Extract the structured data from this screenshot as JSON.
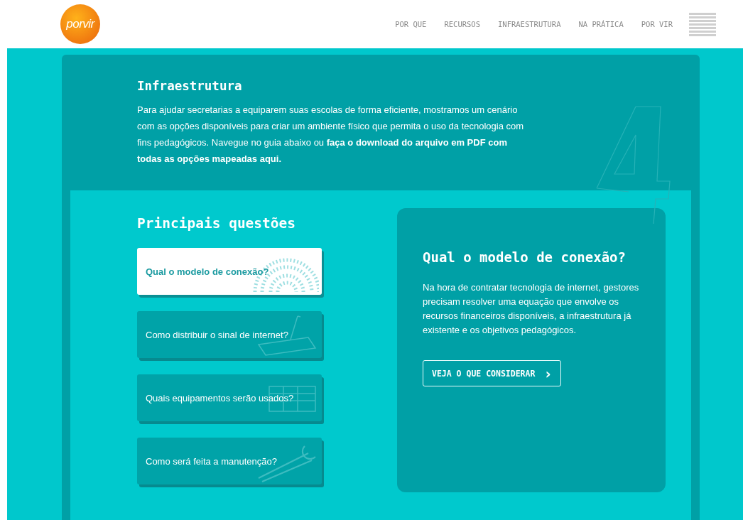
{
  "header": {
    "logo": "porvir",
    "nav": [
      {
        "label": "POR QUE"
      },
      {
        "label": "RECURSOS"
      },
      {
        "label": "INFRAESTRUTURA"
      },
      {
        "label": "NA PRÁTICA"
      },
      {
        "label": "POR VIR"
      }
    ]
  },
  "intro": {
    "title": "Infraestrutura",
    "text": "Para ajudar secretarias a equiparem suas escolas de forma eficiente, mostramos um cenário com as opções disponíveis para criar um ambiente físico que permita o uso da tecnologia com fins pedagógicos. Navegue no guia abaixo ou **faça o download do arquivo em PDF com todas as opções mapeadas aqui.**"
  },
  "questions": {
    "title": "Principais questões",
    "items": [
      {
        "label": "Qual o modelo de conexão?",
        "selected": true
      },
      {
        "label": "Como distribuir o sinal de internet?",
        "selected": false
      },
      {
        "label": "Quais equipamentos serão usados?",
        "selected": false
      },
      {
        "label": "Como será feita a manutenção?",
        "selected": false
      }
    ]
  },
  "detail": {
    "title": "Qual o modelo de conexão?",
    "text": "Na hora de contratar tecnologia de internet, gestores precisam resolver uma equação que envolve os recursos financeiros disponíveis, a infraestrutura já existente e os objetivos pedagógicos.",
    "button": "VEJA O QUE CONSIDERAR",
    "button_icon": "›"
  }
}
